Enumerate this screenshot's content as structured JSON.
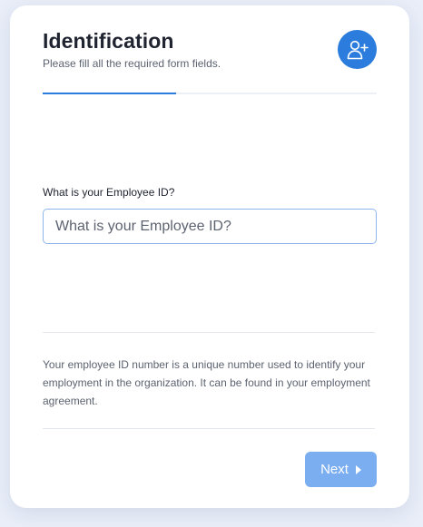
{
  "form": {
    "title": "Identification",
    "subtitle": "Please fill all the required form fields.",
    "progress_fraction": 0.4,
    "field": {
      "label": "What is your Employee ID?",
      "placeholder": "What is your Employee ID?",
      "value": ""
    },
    "help_text": "Your employee ID number is a unique number used to identify your employment in the organization. It can be found in your employment agreement.",
    "next_label": "Next"
  },
  "icons": {
    "header": "add-user-icon",
    "next": "caret-right-icon"
  },
  "colors": {
    "accent": "#2b7cdc",
    "next_button": "#7aaef0",
    "background": "#e9eef8"
  }
}
